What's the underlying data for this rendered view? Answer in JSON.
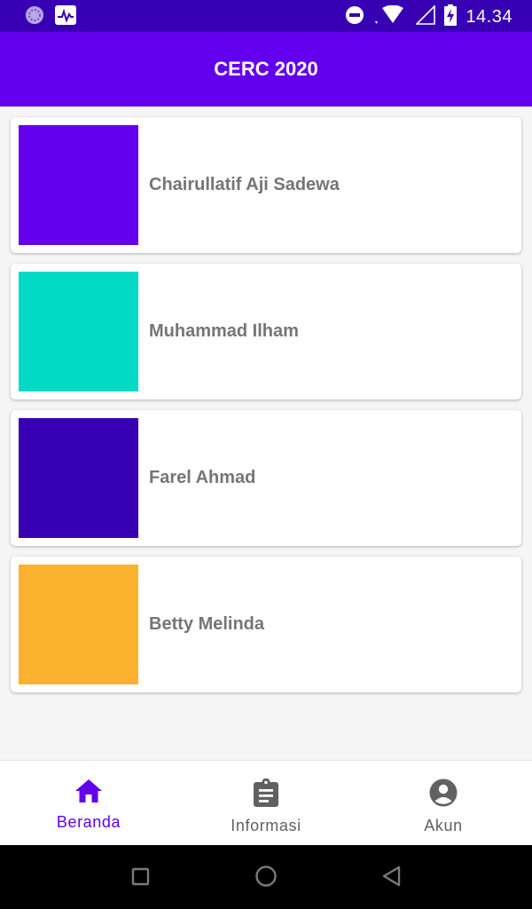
{
  "status_bar": {
    "time": "14.34",
    "left_icons": [
      "app-notification-icon",
      "activity-monitor-icon"
    ],
    "right_icons": [
      "do-not-disturb-icon",
      "wifi-icon",
      "signal-icon",
      "battery-charging-icon"
    ]
  },
  "app_bar": {
    "title": "CERC 2020"
  },
  "members": [
    {
      "name": "Chairullatif Aji Sadewa",
      "color": "#6200ee"
    },
    {
      "name": "Muhammad Ilham",
      "color": "#03dac5"
    },
    {
      "name": "Farel Ahmad",
      "color": "#3700b3"
    },
    {
      "name": "Betty Melinda",
      "color": "#fbb22e"
    }
  ],
  "bottom_nav": {
    "items": [
      {
        "label": "Beranda",
        "icon": "home-icon",
        "active": true
      },
      {
        "label": "Informasi",
        "icon": "clipboard-icon",
        "active": false
      },
      {
        "label": "Akun",
        "icon": "account-circle-icon",
        "active": false
      }
    ]
  },
  "system_nav": {
    "buttons": [
      "recents-icon",
      "home-circle-icon",
      "back-icon"
    ]
  },
  "colors": {
    "primary": "#6200ee",
    "primary_dark": "#3700b3",
    "inactive": "#616161"
  }
}
